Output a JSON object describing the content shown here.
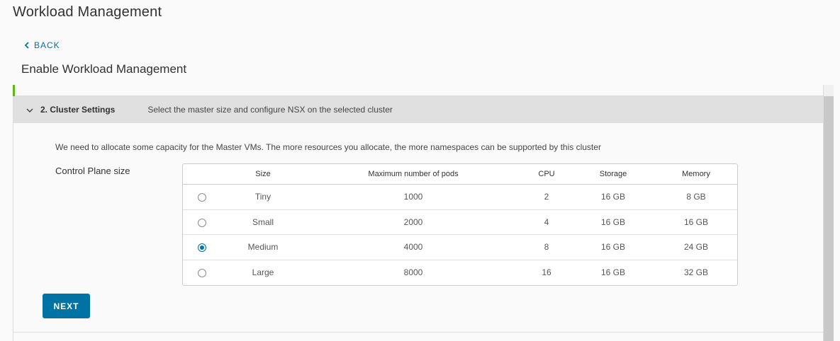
{
  "page": {
    "title": "Workload Management",
    "back_label": "BACK",
    "subtitle": "Enable Workload Management"
  },
  "step": {
    "title": "2. Cluster Settings",
    "description": "Select the master size and configure NSX on the selected cluster",
    "expanded": true
  },
  "content": {
    "intro": "We need to allocate some capacity for the Master VMs. The more resources you allocate, the more namespaces can be supported by this cluster",
    "control_plane_label": "Control Plane size"
  },
  "table": {
    "headers": {
      "size": "Size",
      "pods": "Maximum number of pods",
      "cpu": "CPU",
      "storage": "Storage",
      "memory": "Memory"
    },
    "rows": [
      {
        "size": "Tiny",
        "pods": "1000",
        "cpu": "2",
        "storage": "16 GB",
        "memory": "8 GB",
        "selected": false
      },
      {
        "size": "Small",
        "pods": "2000",
        "cpu": "4",
        "storage": "16 GB",
        "memory": "16 GB",
        "selected": false
      },
      {
        "size": "Medium",
        "pods": "4000",
        "cpu": "8",
        "storage": "16 GB",
        "memory": "24 GB",
        "selected": true
      },
      {
        "size": "Large",
        "pods": "8000",
        "cpu": "16",
        "storage": "16 GB",
        "memory": "32 GB",
        "selected": false
      }
    ]
  },
  "actions": {
    "next_label": "NEXT"
  },
  "icons": {
    "back": "chevron-left-icon",
    "step_toggle": "chevron-down-icon"
  },
  "colors": {
    "accent": "#0072a3",
    "step_complete": "#5eb715",
    "step_header_bg": "#e0e0e0"
  }
}
